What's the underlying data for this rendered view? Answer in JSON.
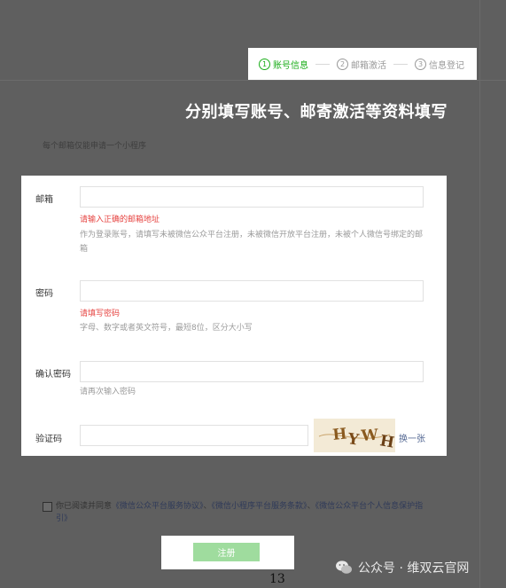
{
  "stepper": {
    "steps": [
      {
        "num": "1",
        "label": "账号信息"
      },
      {
        "num": "2",
        "label": "邮箱激活"
      },
      {
        "num": "3",
        "label": "信息登记"
      }
    ]
  },
  "headline": "分别填写账号、邮寄激活等资料填写",
  "hint": "每个邮箱仅能申请一个小程序",
  "form": {
    "email": {
      "label": "邮箱",
      "value": "",
      "error": "请输入正确的邮箱地址",
      "tip": "作为登录账号，请填写未被微信公众平台注册，未被微信开放平台注册，未被个人微信号绑定的邮箱"
    },
    "password": {
      "label": "密码",
      "value": "",
      "error": "请填写密码",
      "tip": "字母、数字或者英文符号，最短8位，区分大小写"
    },
    "confirm": {
      "label": "确认密码",
      "value": "",
      "tip": "请再次输入密码"
    },
    "captcha": {
      "label": "验证码",
      "value": "",
      "refresh": "换一张",
      "image_text": "HYWH"
    }
  },
  "agreement": {
    "prefix": "你已阅读并同意",
    "link1": "《微信公众平台服务协议》",
    "sep1": "、",
    "link2": "《微信小程序平台服务条款》",
    "sep2": "、",
    "link3": "《微信公众平台个人信息保护指引》"
  },
  "submit_label": "注册",
  "page_number": "13",
  "watermark": "公众号 · 维双云官网",
  "colors": {
    "accent": "#1aad19",
    "error": "#e64340",
    "link": "#576b95"
  }
}
